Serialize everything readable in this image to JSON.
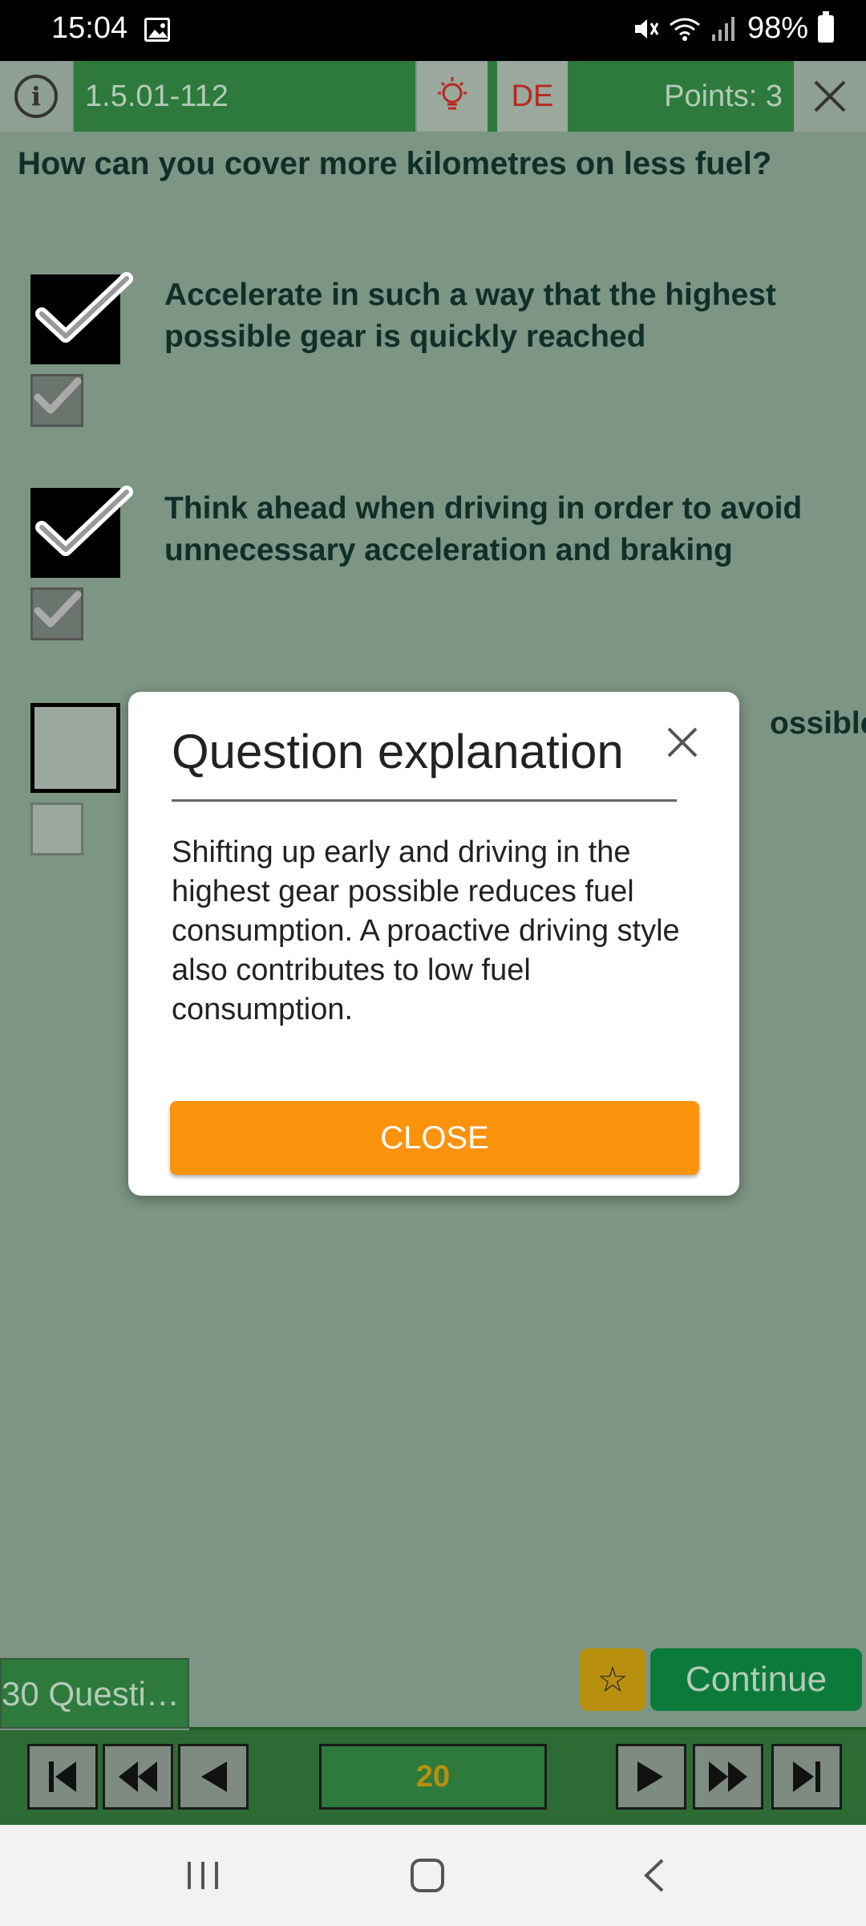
{
  "status_bar": {
    "time": "15:04",
    "battery": "98%",
    "icons": [
      "image-icon",
      "mute-icon",
      "wifi-icon",
      "signal-icon",
      "battery-icon"
    ]
  },
  "toolbar": {
    "question_id": "1.5.01-112",
    "language": "DE",
    "points": "Points: 3",
    "icons": [
      "info-icon",
      "lightbulb-icon",
      "close-icon"
    ]
  },
  "question": {
    "text": "How can you cover more kilometres on less fuel?"
  },
  "answers": [
    {
      "text": "Accelerate in such a way that the highest possible gear is quickly reached",
      "checked": true,
      "correct": true
    },
    {
      "text": "Think ahead when driving in order to avoid unnecessary acceleration and braking",
      "checked": true,
      "correct": true
    },
    {
      "text": "ossible",
      "checked": false,
      "correct": false
    }
  ],
  "modal": {
    "title": "Question explanation",
    "body": "Shifting up early and driving in the highest gear possible reduces fuel consumption. A proactive driving style also contributes to low fuel consumption.",
    "close_label": "CLOSE"
  },
  "bottom": {
    "question_count": "30 Questi…",
    "continue_label": "Continue",
    "star_icon": "star-icon"
  },
  "navigation": {
    "page": "20",
    "buttons": [
      "first-icon",
      "rewind-icon",
      "previous-icon",
      "next-icon",
      "fast-forward-icon",
      "last-icon"
    ]
  },
  "system_nav": [
    "recents-icon",
    "home-icon",
    "back-icon"
  ],
  "colors": {
    "toolbar_green": "#2d7a3c",
    "background": "#7d9584",
    "accent_orange": "#fb930d",
    "language_red": "#b8281f",
    "page_gold": "#b8900e"
  }
}
